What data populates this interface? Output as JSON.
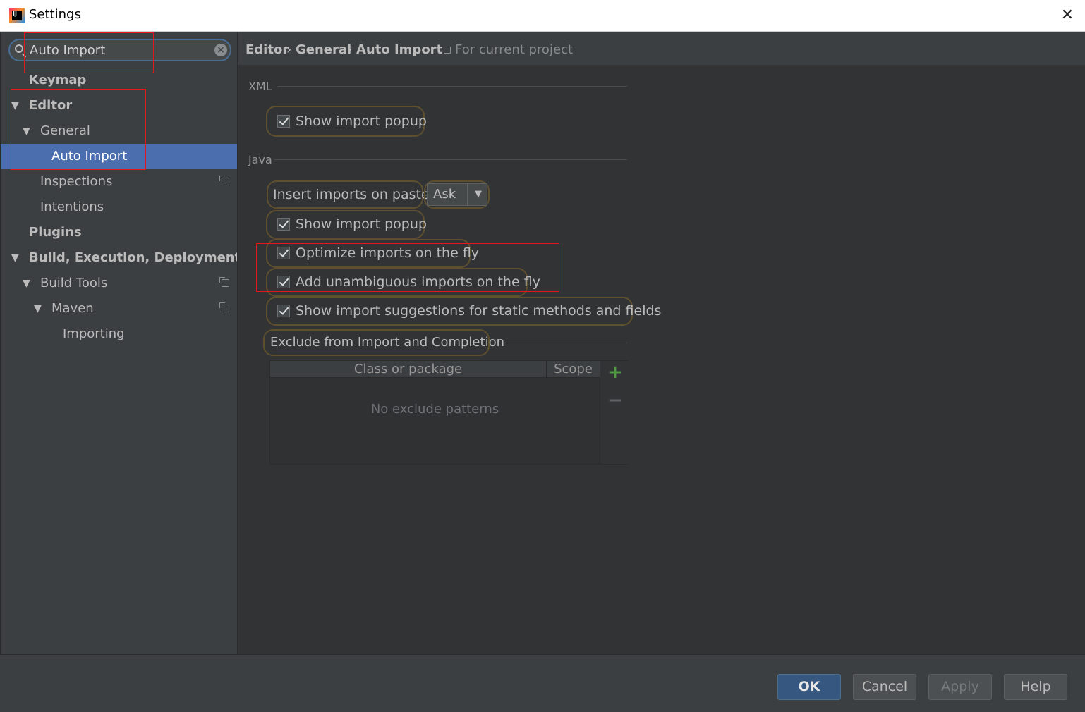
{
  "window": {
    "title": "Settings"
  },
  "search": {
    "value": "Auto Import"
  },
  "sidebar": {
    "items": [
      {
        "label": "Keymap"
      },
      {
        "label": "Editor"
      },
      {
        "label": "General"
      },
      {
        "label": "Auto Import"
      },
      {
        "label": "Inspections"
      },
      {
        "label": "Intentions"
      },
      {
        "label": "Plugins"
      },
      {
        "label": "Build, Execution, Deployment"
      },
      {
        "label": "Build Tools"
      },
      {
        "label": "Maven"
      },
      {
        "label": "Importing"
      }
    ]
  },
  "breadcrumb": {
    "items": [
      "Editor",
      "General",
      "Auto Import"
    ],
    "separator": "›",
    "scope_note": "For current project"
  },
  "xml": {
    "section_label": "XML",
    "show_import_popup": {
      "label": "Show import popup",
      "checked": true
    }
  },
  "java": {
    "section_label": "Java",
    "insert_on_paste": {
      "label": "Insert imports on paste:",
      "value": "Ask"
    },
    "show_import_popup": {
      "label": "Show import popup",
      "checked": true
    },
    "optimize_on_fly": {
      "label": "Optimize imports on the fly",
      "checked": true
    },
    "add_unambiguous": {
      "label": "Add unambiguous imports on the fly",
      "checked": true
    },
    "static_suggestions": {
      "label": "Show import suggestions for static methods and fields",
      "checked": true
    }
  },
  "exclude": {
    "section_label": "Exclude from Import and Completion",
    "columns": [
      "Class or package",
      "Scope"
    ],
    "empty_text": "No exclude patterns"
  },
  "footer": {
    "ok_label": "OK",
    "cancel_label": "Cancel",
    "apply_label": "Apply",
    "help_label": "Help"
  },
  "colors": {
    "selection": "#4b6eaf",
    "annotation_red": "#e0191e",
    "add_green": "#4f9a43",
    "ok_button": "#365880"
  }
}
